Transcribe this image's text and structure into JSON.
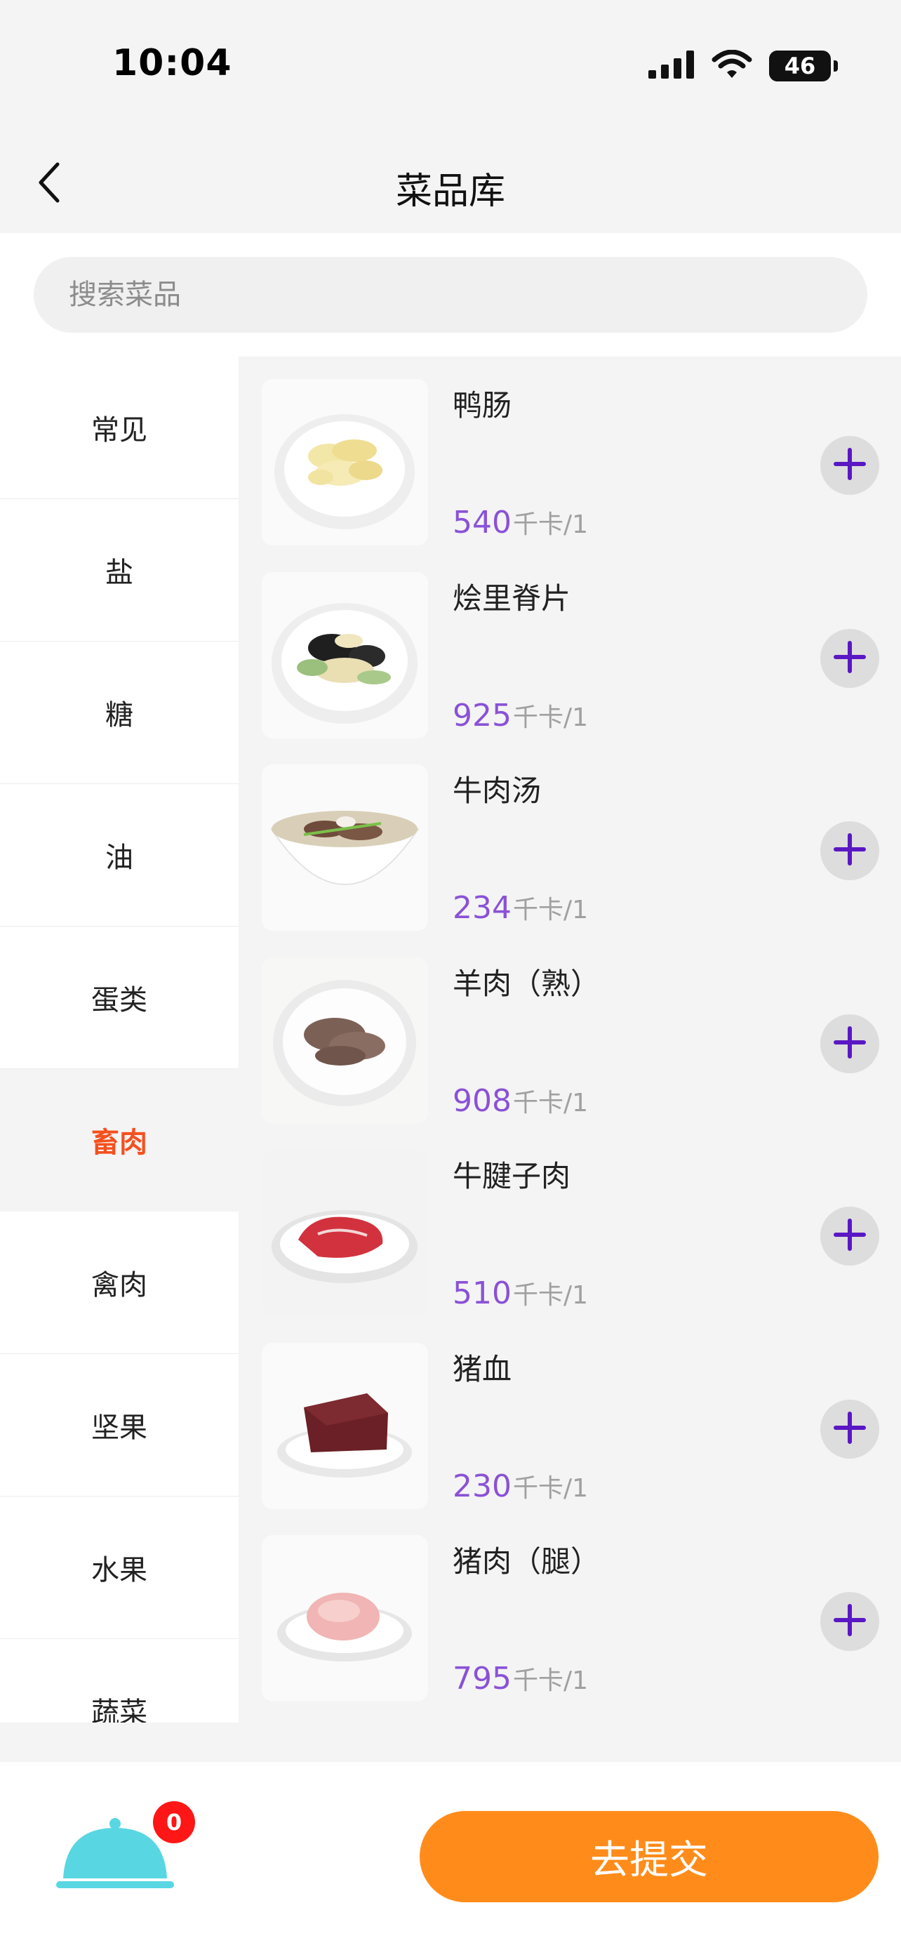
{
  "status_bar": {
    "time": "10:04",
    "battery": "46"
  },
  "nav": {
    "title": "菜品库"
  },
  "search": {
    "placeholder": "搜索菜品"
  },
  "categories": [
    {
      "label": "常见",
      "active": false
    },
    {
      "label": "盐",
      "active": false
    },
    {
      "label": "糖",
      "active": false
    },
    {
      "label": "油",
      "active": false
    },
    {
      "label": "蛋类",
      "active": false
    },
    {
      "label": "畜肉",
      "active": true
    },
    {
      "label": "禽肉",
      "active": false
    },
    {
      "label": "坚果",
      "active": false
    },
    {
      "label": "水果",
      "active": false
    },
    {
      "label": "蔬菜",
      "active": false
    }
  ],
  "dishes": [
    {
      "name": "鸭肠",
      "calories": "540",
      "unit": "千卡/1"
    },
    {
      "name": "烩里脊片",
      "calories": "925",
      "unit": "千卡/1"
    },
    {
      "name": "牛肉汤",
      "calories": "234",
      "unit": "千卡/1"
    },
    {
      "name": "羊肉（熟）",
      "calories": "908",
      "unit": "千卡/1"
    },
    {
      "name": "牛腱子肉",
      "calories": "510",
      "unit": "千卡/1"
    },
    {
      "name": "猪血",
      "calories": "230",
      "unit": "千卡/1"
    },
    {
      "name": "猪肉（腿）",
      "calories": "795",
      "unit": "千卡/1"
    }
  ],
  "cart": {
    "count": "0"
  },
  "submit": {
    "label": "去提交"
  },
  "colors": {
    "accent_orange": "#ff8c1a",
    "active_category": "#f5501e",
    "calorie_purple": "#8a52d6",
    "plus_purple": "#5a17c4",
    "cart_cyan": "#58d7e3",
    "badge_red": "#ff1616"
  }
}
